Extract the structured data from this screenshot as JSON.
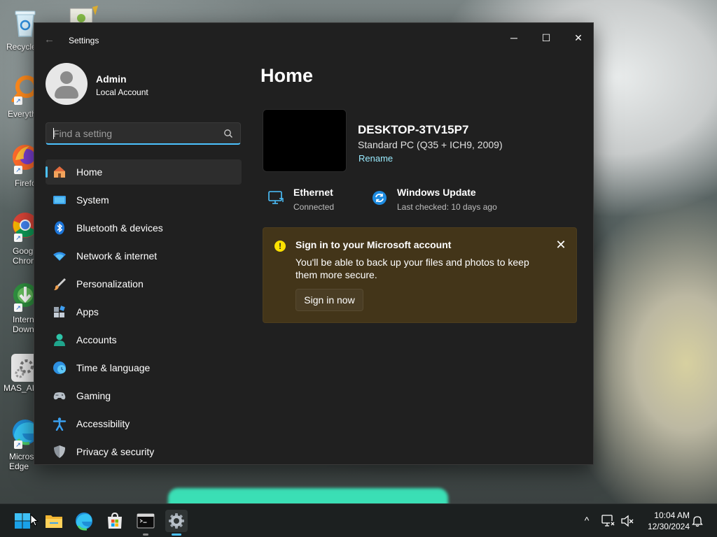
{
  "desktop": {
    "icons": [
      {
        "label": "Recycle",
        "icon": "recycle-bin-icon"
      },
      {
        "label": "Everyth",
        "icon": "everything-search-icon"
      },
      {
        "label": "Firefo",
        "icon": "firefox-icon"
      },
      {
        "label": "Goog Chron",
        "icon": "chrome-icon"
      },
      {
        "label": "Intern Downl",
        "icon": "internet-download-manager-icon"
      },
      {
        "label": "MAS_AI",
        "icon": "mas-ai-icon"
      },
      {
        "label": "Micros Edge",
        "icon": "edge-icon"
      }
    ]
  },
  "settings_window": {
    "title": "Settings",
    "controls": {
      "minimize": "─",
      "maximize": "☐",
      "close": "✕"
    },
    "user": {
      "name": "Admin",
      "account_type": "Local Account"
    },
    "search": {
      "placeholder": "Find a setting",
      "value": ""
    },
    "nav": [
      {
        "label": "Home",
        "icon": "home-icon",
        "selected": true
      },
      {
        "label": "System",
        "icon": "system-icon"
      },
      {
        "label": "Bluetooth & devices",
        "icon": "bluetooth-icon"
      },
      {
        "label": "Network & internet",
        "icon": "network-icon"
      },
      {
        "label": "Personalization",
        "icon": "brush-icon"
      },
      {
        "label": "Apps",
        "icon": "apps-icon"
      },
      {
        "label": "Accounts",
        "icon": "accounts-icon"
      },
      {
        "label": "Time & language",
        "icon": "globe-clock-icon"
      },
      {
        "label": "Gaming",
        "icon": "gamepad-icon"
      },
      {
        "label": "Accessibility",
        "icon": "accessibility-icon"
      },
      {
        "label": "Privacy & security",
        "icon": "shield-icon"
      }
    ],
    "main": {
      "page_title": "Home",
      "device": {
        "name": "DESKTOP-3TV15P7",
        "model": "Standard PC (Q35 + ICH9, 2009)",
        "rename_label": "Rename"
      },
      "status": [
        {
          "title": "Ethernet",
          "subtitle": "Connected",
          "icon": "ethernet-monitor-icon"
        },
        {
          "title": "Windows Update",
          "subtitle": "Last checked: 10 days ago",
          "icon": "windows-update-icon"
        }
      ],
      "banner": {
        "title": "Sign in to your Microsoft account",
        "body": "You'll be able to back up your files and photos to keep them more secure.",
        "button_label": "Sign in now",
        "close_glyph": "✕",
        "warning_glyph": "!"
      }
    }
  },
  "taskbar": {
    "apps": [
      {
        "name": "start",
        "icon": "windows-start-icon"
      },
      {
        "name": "file-explorer",
        "icon": "folder-icon"
      },
      {
        "name": "edge",
        "icon": "edge-icon"
      },
      {
        "name": "store",
        "icon": "store-icon"
      },
      {
        "name": "terminal",
        "icon": "terminal-icon"
      },
      {
        "name": "settings",
        "icon": "gear-icon",
        "active": true
      }
    ],
    "tray": {
      "chevron": "^",
      "time": "10:04 AM",
      "date": "12/30/2024"
    }
  },
  "colors": {
    "accent": "#4cc2ff",
    "window_bg": "#202020",
    "banner_bg": "#433519",
    "warning": "#fce100",
    "link": "#99ebff"
  }
}
